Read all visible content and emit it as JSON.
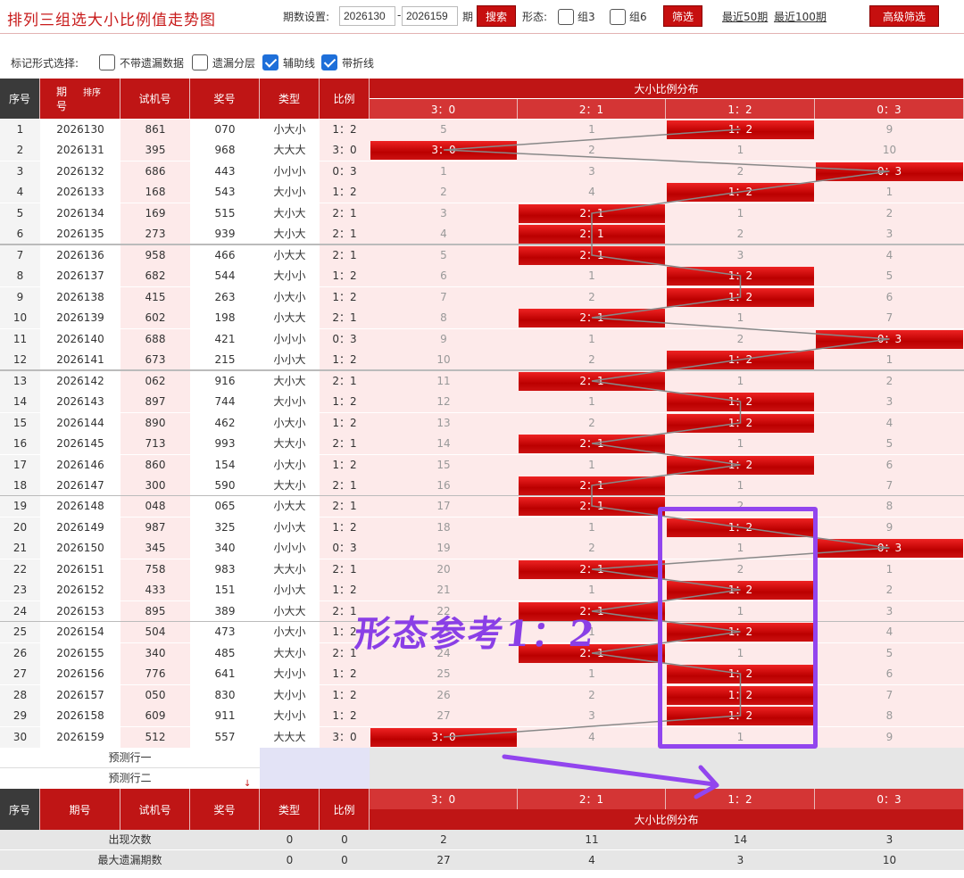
{
  "header": {
    "title": "排列三组选大小比例值走势图",
    "period_label": "期数设置:",
    "period_from": "2026130",
    "period_to": "2026159",
    "period_unit": "期",
    "search_label": "搜索",
    "shape_label": "形态:",
    "group3_label": "组3",
    "group6_label": "组6",
    "filter_label": "筛选",
    "recent50": "最近50期",
    "recent100": "最近100期",
    "advanced_label": "高级筛选"
  },
  "marks": {
    "label": "标记形式选择:",
    "no_miss": "不带遗漏数据",
    "miss_layer": "遗漏分层",
    "aux_line": "辅助线",
    "fold_line": "带折线"
  },
  "columns": {
    "seq": "序号",
    "period": "期号",
    "sort": "排序",
    "trial": "试机号",
    "prize": "奖号",
    "type": "类型",
    "ratio": "比例",
    "dist": "大小比例分布",
    "r30": "3：0",
    "r21": "2：1",
    "r12": "1：2",
    "r03": "0：3"
  },
  "period_header_top": "期",
  "period_header_bottom": "号",
  "rows": [
    {
      "seq": "1",
      "period": "2026130",
      "trial": "861",
      "prize": "070",
      "type": "小大小",
      "ratio": "1：2",
      "c": [
        5,
        1,
        "H",
        9
      ]
    },
    {
      "seq": "2",
      "period": "2026131",
      "trial": "395",
      "prize": "968",
      "type": "大大大",
      "ratio": "3：0",
      "c": [
        "H",
        2,
        1,
        10
      ]
    },
    {
      "seq": "3",
      "period": "2026132",
      "trial": "686",
      "prize": "443",
      "type": "小小小",
      "ratio": "0：3",
      "c": [
        1,
        3,
        2,
        "H"
      ]
    },
    {
      "seq": "4",
      "period": "2026133",
      "trial": "168",
      "prize": "543",
      "type": "大小小",
      "ratio": "1：2",
      "c": [
        2,
        4,
        "H",
        1
      ]
    },
    {
      "seq": "5",
      "period": "2026134",
      "trial": "169",
      "prize": "515",
      "type": "大小大",
      "ratio": "2：1",
      "c": [
        3,
        "H",
        1,
        2
      ]
    },
    {
      "seq": "6",
      "period": "2026135",
      "trial": "273",
      "prize": "939",
      "type": "大小大",
      "ratio": "2：1",
      "c": [
        4,
        "H",
        2,
        3
      ]
    },
    {
      "seq": "7",
      "period": "2026136",
      "trial": "958",
      "prize": "466",
      "type": "小大大",
      "ratio": "2：1",
      "c": [
        5,
        "H",
        3,
        4
      ]
    },
    {
      "seq": "8",
      "period": "2026137",
      "trial": "682",
      "prize": "544",
      "type": "大小小",
      "ratio": "1：2",
      "c": [
        6,
        1,
        "H",
        5
      ]
    },
    {
      "seq": "9",
      "period": "2026138",
      "trial": "415",
      "prize": "263",
      "type": "小大小",
      "ratio": "1：2",
      "c": [
        7,
        2,
        "H",
        6
      ]
    },
    {
      "seq": "10",
      "period": "2026139",
      "trial": "602",
      "prize": "198",
      "type": "小大大",
      "ratio": "2：1",
      "c": [
        8,
        "H",
        1,
        7
      ]
    },
    {
      "seq": "11",
      "period": "2026140",
      "trial": "688",
      "prize": "421",
      "type": "小小小",
      "ratio": "0：3",
      "c": [
        9,
        1,
        2,
        "H"
      ]
    },
    {
      "seq": "12",
      "period": "2026141",
      "trial": "673",
      "prize": "215",
      "type": "小小大",
      "ratio": "1：2",
      "c": [
        10,
        2,
        "H",
        1
      ]
    },
    {
      "seq": "13",
      "period": "2026142",
      "trial": "062",
      "prize": "916",
      "type": "大小大",
      "ratio": "2：1",
      "c": [
        11,
        "H",
        1,
        2
      ]
    },
    {
      "seq": "14",
      "period": "2026143",
      "trial": "897",
      "prize": "744",
      "type": "大小小",
      "ratio": "1：2",
      "c": [
        12,
        1,
        "H",
        3
      ]
    },
    {
      "seq": "15",
      "period": "2026144",
      "trial": "890",
      "prize": "462",
      "type": "小大小",
      "ratio": "1：2",
      "c": [
        13,
        2,
        "H",
        4
      ]
    },
    {
      "seq": "16",
      "period": "2026145",
      "trial": "713",
      "prize": "993",
      "type": "大大小",
      "ratio": "2：1",
      "c": [
        14,
        "H",
        1,
        5
      ]
    },
    {
      "seq": "17",
      "period": "2026146",
      "trial": "860",
      "prize": "154",
      "type": "小大小",
      "ratio": "1：2",
      "c": [
        15,
        1,
        "H",
        6
      ]
    },
    {
      "seq": "18",
      "period": "2026147",
      "trial": "300",
      "prize": "590",
      "type": "大大小",
      "ratio": "2：1",
      "c": [
        16,
        "H",
        1,
        7
      ]
    },
    {
      "seq": "19",
      "period": "2026148",
      "trial": "048",
      "prize": "065",
      "type": "小大大",
      "ratio": "2：1",
      "c": [
        17,
        "H",
        2,
        8
      ]
    },
    {
      "seq": "20",
      "period": "2026149",
      "trial": "987",
      "prize": "325",
      "type": "小小大",
      "ratio": "1：2",
      "c": [
        18,
        1,
        "H",
        9
      ]
    },
    {
      "seq": "21",
      "period": "2026150",
      "trial": "345",
      "prize": "340",
      "type": "小小小",
      "ratio": "0：3",
      "c": [
        19,
        2,
        1,
        "H"
      ]
    },
    {
      "seq": "22",
      "period": "2026151",
      "trial": "758",
      "prize": "983",
      "type": "大大小",
      "ratio": "2：1",
      "c": [
        20,
        "H",
        2,
        1
      ]
    },
    {
      "seq": "23",
      "period": "2026152",
      "trial": "433",
      "prize": "151",
      "type": "小小大",
      "ratio": "1：2",
      "c": [
        21,
        1,
        "H",
        2
      ]
    },
    {
      "seq": "24",
      "period": "2026153",
      "trial": "895",
      "prize": "389",
      "type": "小大大",
      "ratio": "2：1",
      "c": [
        22,
        "H",
        1,
        3
      ]
    },
    {
      "seq": "25",
      "period": "2026154",
      "trial": "504",
      "prize": "473",
      "type": "小大小",
      "ratio": "1：2",
      "c": [
        23,
        1,
        "H",
        4
      ]
    },
    {
      "seq": "26",
      "period": "2026155",
      "trial": "340",
      "prize": "485",
      "type": "大大小",
      "ratio": "2：1",
      "c": [
        24,
        "H",
        1,
        5
      ]
    },
    {
      "seq": "27",
      "period": "2026156",
      "trial": "776",
      "prize": "641",
      "type": "大小小",
      "ratio": "1：2",
      "c": [
        25,
        1,
        "H",
        6
      ]
    },
    {
      "seq": "28",
      "period": "2026157",
      "trial": "050",
      "prize": "830",
      "type": "大小小",
      "ratio": "1：2",
      "c": [
        26,
        2,
        "H",
        7
      ]
    },
    {
      "seq": "29",
      "period": "2026158",
      "trial": "609",
      "prize": "911",
      "type": "大小小",
      "ratio": "1：2",
      "c": [
        27,
        3,
        "H",
        8
      ]
    },
    {
      "seq": "30",
      "period": "2026159",
      "trial": "512",
      "prize": "557",
      "type": "大大大",
      "ratio": "3：0",
      "c": [
        "H",
        4,
        1,
        9
      ]
    }
  ],
  "predict": {
    "row1": "预测行一",
    "row2": "预测行二"
  },
  "stats": [
    {
      "label": "出现次数",
      "type": "0",
      "ratio": "0",
      "v": [
        "2",
        "11",
        "14",
        "3"
      ]
    },
    {
      "label": "最大遗漏期数",
      "type": "0",
      "ratio": "0",
      "v": [
        "27",
        "4",
        "3",
        "10"
      ]
    }
  ],
  "annotation": "形态参考1：2",
  "colors": {
    "accent": "#bf1515",
    "annotation": "#9245ee"
  }
}
